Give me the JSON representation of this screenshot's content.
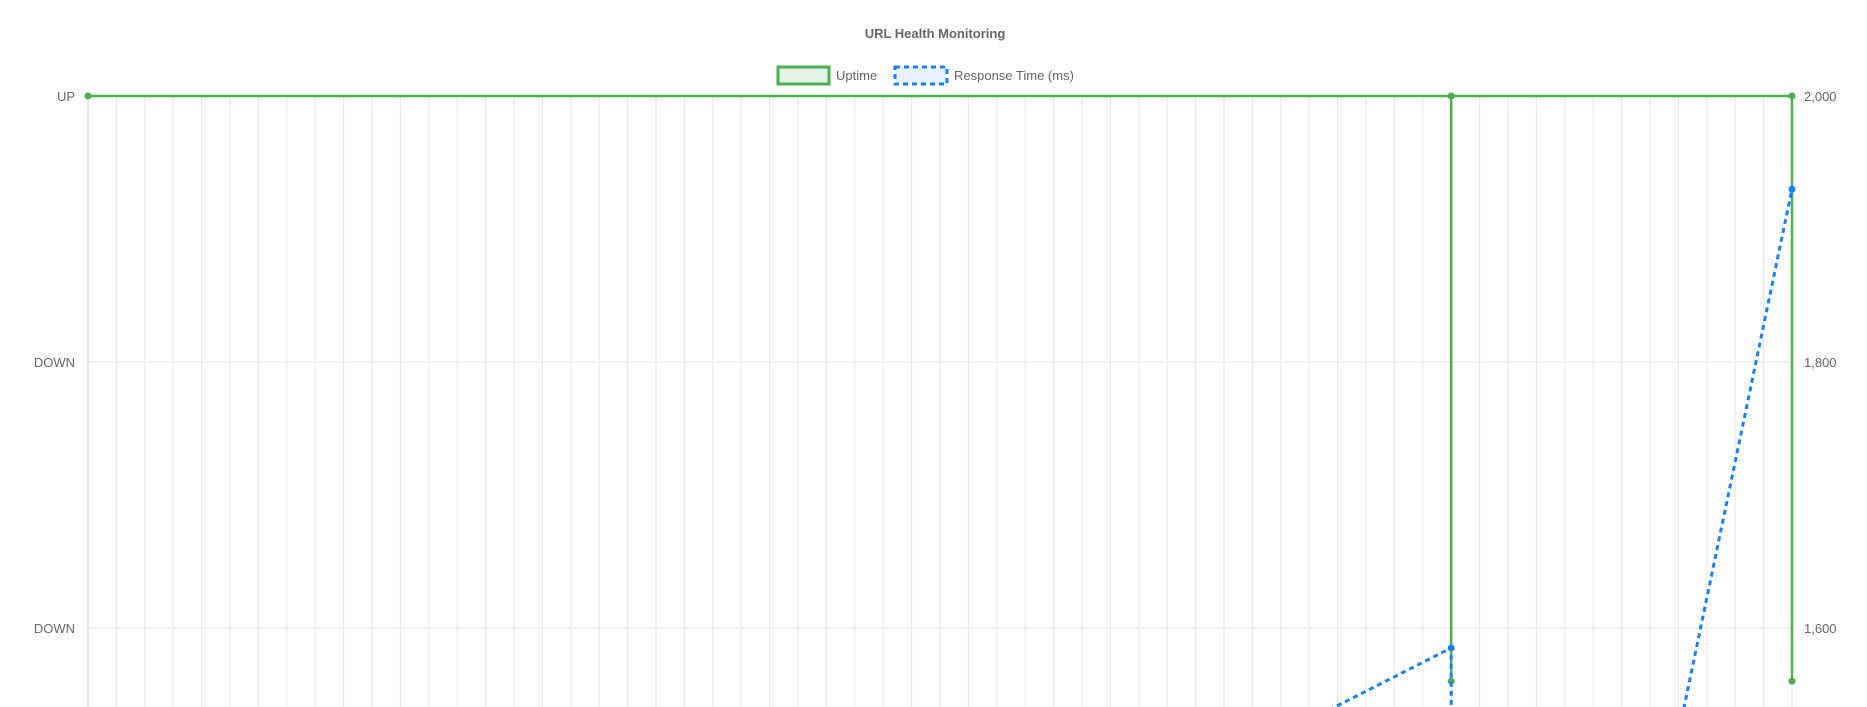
{
  "chart_data": {
    "type": "line",
    "title": "URL Health Monitoring",
    "legend": {
      "position": "top",
      "items": [
        {
          "label": "Uptime",
          "color": "#4caf50",
          "style": "solid-box"
        },
        {
          "label": "Response Time (ms)",
          "color": "#1a80ff",
          "style": "dashed-box"
        }
      ]
    },
    "grid": true,
    "x_point_count": 61,
    "y_left": {
      "tick_labels": [
        "UP",
        "DOWN",
        "DOWN"
      ],
      "tick_values": [
        1,
        0,
        -1
      ]
    },
    "y_right": {
      "tick_labels": [
        "2,000",
        "1,800",
        "1,600"
      ],
      "tick_values": [
        2000,
        1800,
        1600
      ],
      "ylim": [
        1480,
        2000
      ]
    },
    "series": [
      {
        "name": "Uptime",
        "color": "#4caf50",
        "axis": "left",
        "points": [
          {
            "x": 0,
            "y": 1
          },
          {
            "x": 48,
            "y": 1
          },
          {
            "x": 48,
            "y": -1.2
          },
          {
            "x": 48,
            "y": 1
          },
          {
            "x": 60,
            "y": 1
          },
          {
            "x": 60,
            "y": -1.2
          }
        ]
      },
      {
        "name": "Response Time (ms)",
        "color": "#1a80ff",
        "axis": "right",
        "points": [
          {
            "x": 42,
            "y": 1520
          },
          {
            "x": 48,
            "y": 1585
          },
          {
            "x": 48,
            "y": 1520
          },
          {
            "x": 56,
            "y": 1520
          },
          {
            "x": 60,
            "y": 1930
          }
        ]
      }
    ]
  }
}
